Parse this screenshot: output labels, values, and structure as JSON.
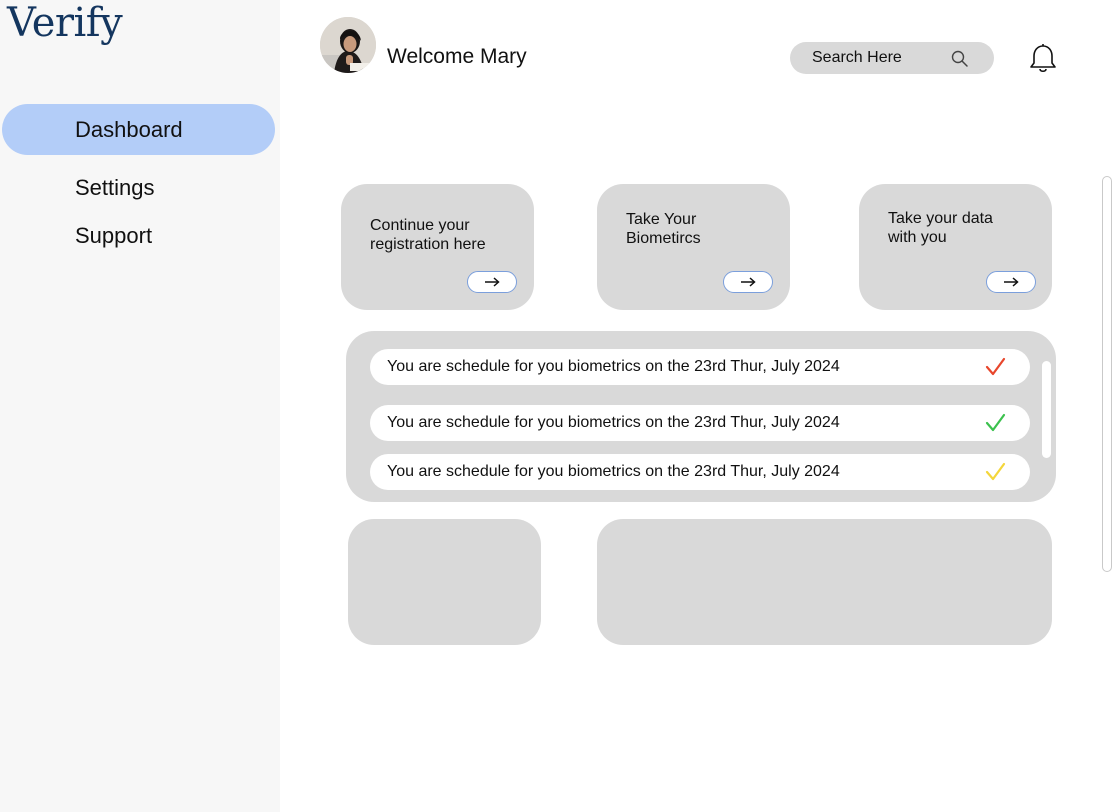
{
  "app": {
    "logo": "Verify"
  },
  "sidebar": {
    "items": [
      {
        "label": "Dashboard",
        "active": true
      },
      {
        "label": "Settings",
        "active": false
      },
      {
        "label": "Support",
        "active": false
      }
    ]
  },
  "header": {
    "welcome": "Welcome Mary",
    "search": {
      "placeholder": "Search Here"
    },
    "icons": {
      "search": "search-icon",
      "notifications": "bell-icon"
    }
  },
  "cards": [
    {
      "text": "Continue your registration here",
      "action_icon": "arrow-right-icon"
    },
    {
      "text": "Take Your Biometircs",
      "action_icon": "arrow-right-icon"
    },
    {
      "text": "Take your data with you",
      "action_icon": "arrow-right-icon"
    }
  ],
  "schedule": {
    "rows": [
      {
        "text": "You are schedule for you biometrics on the 23rd Thur, July 2024",
        "status_icon": "check-icon",
        "status_color": "#e8462c"
      },
      {
        "text": "You are schedule for you biometrics on the 23rd Thur, July 2024",
        "status_icon": "check-icon",
        "status_color": "#3cc14e"
      },
      {
        "text": "You are schedule for you biometrics on the 23rd Thur, July 2024",
        "status_icon": "check-icon",
        "status_color": "#f4d63b"
      }
    ]
  },
  "colors": {
    "sidebar_bg": "#f7f7f7",
    "active_nav": "#b3cdf8",
    "logo": "#14365f",
    "card_bg": "#d9d9d9"
  }
}
